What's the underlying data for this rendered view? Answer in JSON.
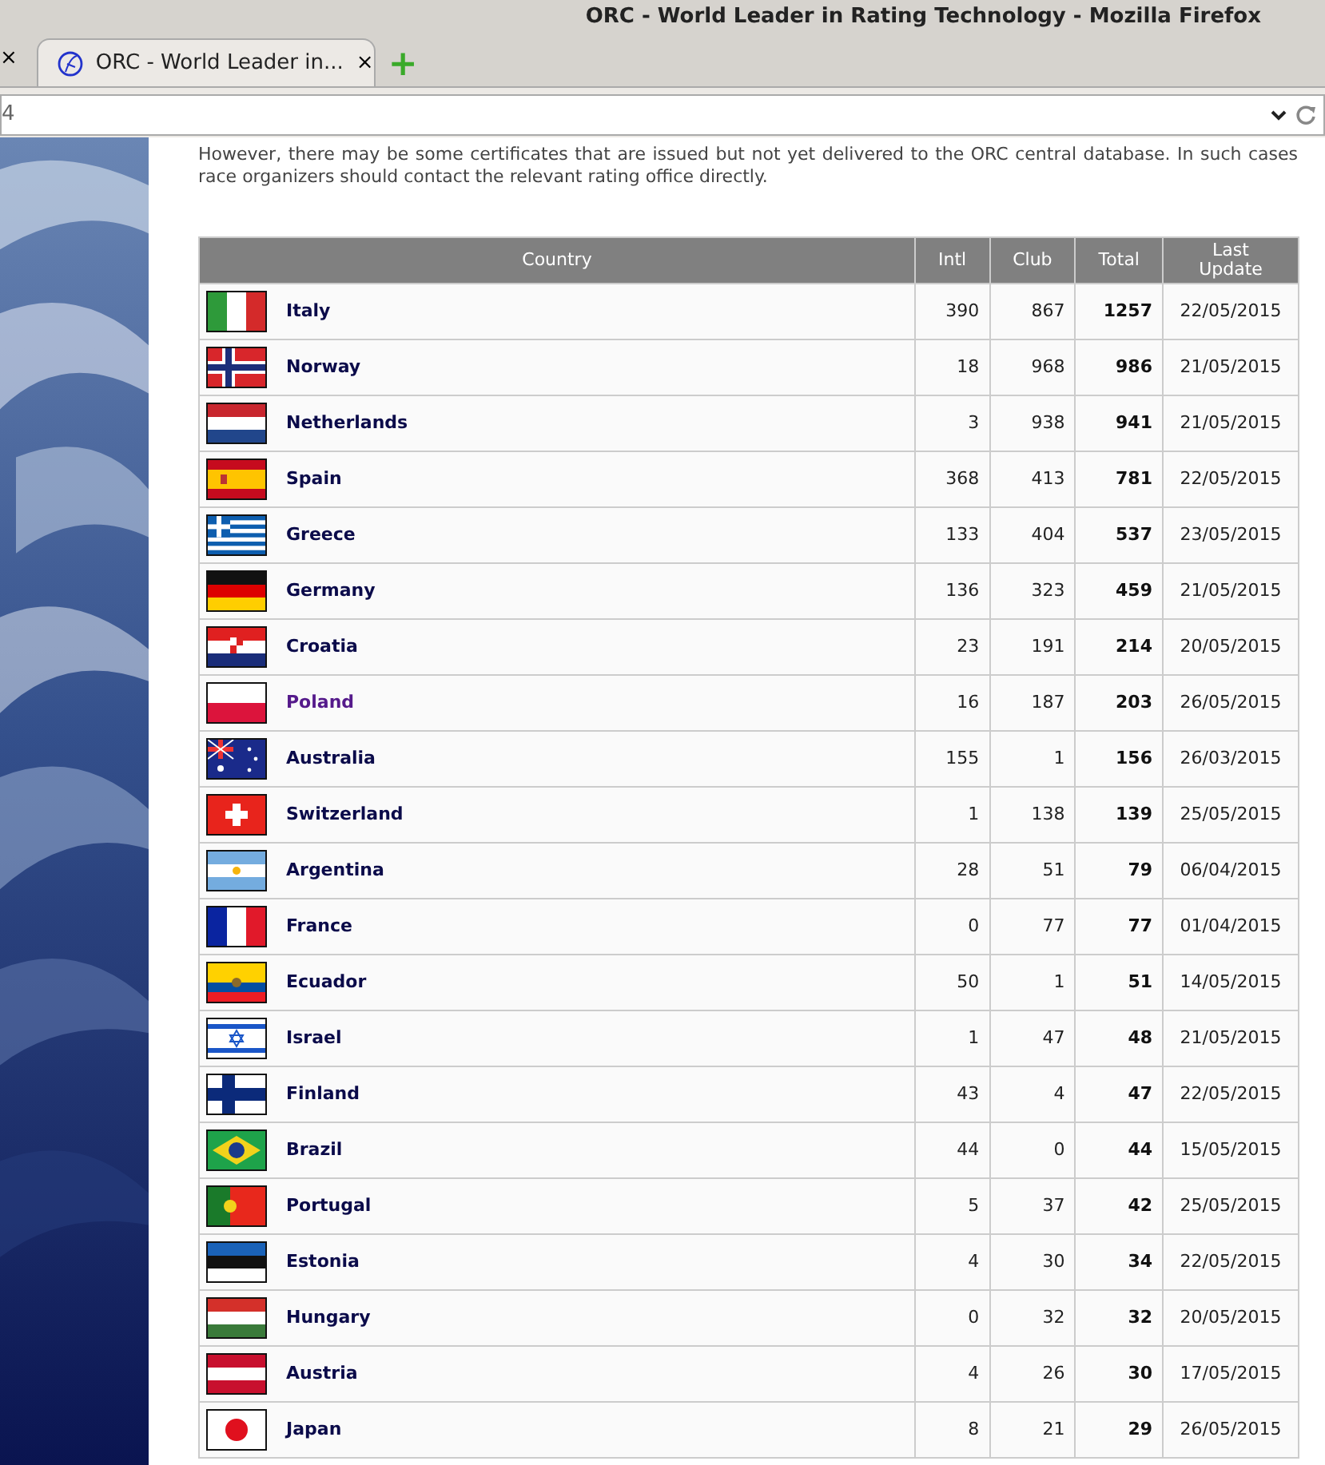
{
  "window": {
    "title": "ORC - World Leader in Rating Technology - Mozilla Firefox"
  },
  "tabs": [
    {
      "label": "ORC - World Leader in...",
      "close": "×",
      "selected": true
    }
  ],
  "prev_tab_close": "×",
  "new_tab": "+",
  "address_bar": {
    "value": "4"
  },
  "intro": [
    "However, there may be some certificates that are issued but not yet delivered to the ORC central database. In such cases race organizers should contact the relevant rating office directly."
  ],
  "table": {
    "columns": [
      "Country",
      "Intl",
      "Club",
      "Total",
      "Last Update"
    ],
    "rows": [
      {
        "country": "Italy",
        "visited": false,
        "intl": "390",
        "club": "867",
        "total": "1257",
        "update": "22/05/2015"
      },
      {
        "country": "Norway",
        "visited": false,
        "intl": "18",
        "club": "968",
        "total": "986",
        "update": "21/05/2015"
      },
      {
        "country": "Netherlands",
        "visited": false,
        "intl": "3",
        "club": "938",
        "total": "941",
        "update": "21/05/2015"
      },
      {
        "country": "Spain",
        "visited": false,
        "intl": "368",
        "club": "413",
        "total": "781",
        "update": "22/05/2015"
      },
      {
        "country": "Greece",
        "visited": false,
        "intl": "133",
        "club": "404",
        "total": "537",
        "update": "23/05/2015"
      },
      {
        "country": "Germany",
        "visited": false,
        "intl": "136",
        "club": "323",
        "total": "459",
        "update": "21/05/2015"
      },
      {
        "country": "Croatia",
        "visited": false,
        "intl": "23",
        "club": "191",
        "total": "214",
        "update": "20/05/2015"
      },
      {
        "country": "Poland",
        "visited": true,
        "intl": "16",
        "club": "187",
        "total": "203",
        "update": "26/05/2015"
      },
      {
        "country": "Australia",
        "visited": false,
        "intl": "155",
        "club": "1",
        "total": "156",
        "update": "26/03/2015"
      },
      {
        "country": "Switzerland",
        "visited": false,
        "intl": "1",
        "club": "138",
        "total": "139",
        "update": "25/05/2015"
      },
      {
        "country": "Argentina",
        "visited": false,
        "intl": "28",
        "club": "51",
        "total": "79",
        "update": "06/04/2015"
      },
      {
        "country": "France",
        "visited": false,
        "intl": "0",
        "club": "77",
        "total": "77",
        "update": "01/04/2015"
      },
      {
        "country": "Ecuador",
        "visited": false,
        "intl": "50",
        "club": "1",
        "total": "51",
        "update": "14/05/2015"
      },
      {
        "country": "Israel",
        "visited": false,
        "intl": "1",
        "club": "47",
        "total": "48",
        "update": "21/05/2015"
      },
      {
        "country": "Finland",
        "visited": false,
        "intl": "43",
        "club": "4",
        "total": "47",
        "update": "22/05/2015"
      },
      {
        "country": "Brazil",
        "visited": false,
        "intl": "44",
        "club": "0",
        "total": "44",
        "update": "15/05/2015"
      },
      {
        "country": "Portugal",
        "visited": false,
        "intl": "5",
        "club": "37",
        "total": "42",
        "update": "25/05/2015"
      },
      {
        "country": "Estonia",
        "visited": false,
        "intl": "4",
        "club": "30",
        "total": "34",
        "update": "22/05/2015"
      },
      {
        "country": "Hungary",
        "visited": false,
        "intl": "0",
        "club": "32",
        "total": "32",
        "update": "20/05/2015"
      },
      {
        "country": "Austria",
        "visited": false,
        "intl": "4",
        "club": "26",
        "total": "30",
        "update": "17/05/2015"
      },
      {
        "country": "Japan",
        "visited": false,
        "intl": "8",
        "club": "21",
        "total": "29",
        "update": "26/05/2015"
      }
    ]
  }
}
